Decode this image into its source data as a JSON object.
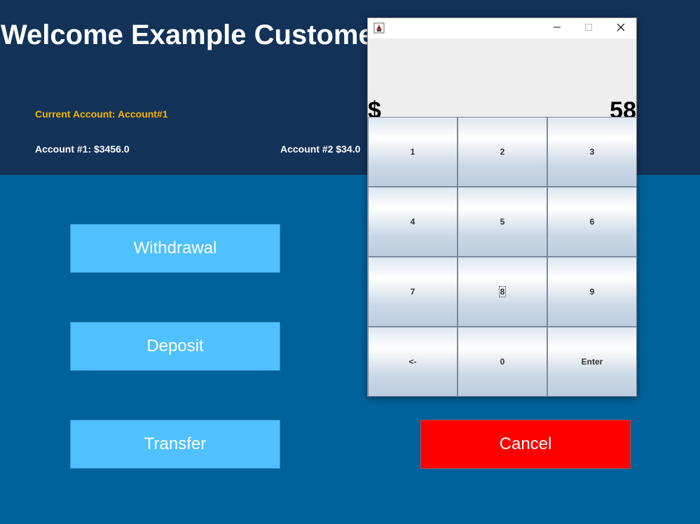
{
  "header": {
    "welcome": "Welcome Example Custome",
    "current_account": "Current Account: Account#1",
    "account1": "Account #1: $3456.0",
    "account2": "Account #2 $34.0"
  },
  "actions": {
    "withdrawal": "Withdrawal",
    "deposit": "Deposit",
    "transfer": "Transfer",
    "cancel": "Cancel"
  },
  "colors": {
    "header_bg": "#123258",
    "page_bg": "#00629b",
    "action_button": "#4fc1fe",
    "cancel_button": "#ff0000",
    "current_account_text": "#f5b400"
  },
  "keypad": {
    "title_icons": {
      "app": "java-app-icon",
      "minimize": "minimize-icon",
      "maximize": "maximize-icon",
      "close": "close-icon"
    },
    "display": {
      "currency": "$",
      "amount": "58"
    },
    "keys": [
      "1",
      "2",
      "3",
      "4",
      "5",
      "6",
      "7",
      "8",
      "9",
      "<-",
      "0",
      "Enter"
    ]
  }
}
